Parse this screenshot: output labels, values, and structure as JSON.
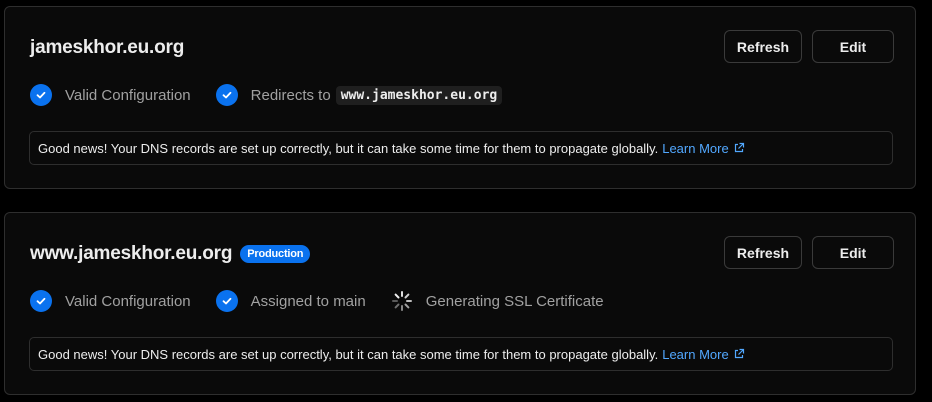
{
  "domains": [
    {
      "name": "jameskhor.eu.org",
      "badge": "",
      "buttons": {
        "refresh": "Refresh",
        "edit": "Edit"
      },
      "statuses": [
        {
          "icon": "check-icon",
          "label": "Valid Configuration"
        },
        {
          "icon": "check-icon",
          "label": "Redirects to",
          "code": "www.jameskhor.eu.org"
        }
      ],
      "notice": {
        "text": "Good news! Your DNS records are set up correctly, but it can take some time for them to propagate globally.",
        "link": "Learn More",
        "link_icon": "external-link-icon"
      }
    },
    {
      "name": "www.jameskhor.eu.org",
      "badge": "Production",
      "buttons": {
        "refresh": "Refresh",
        "edit": "Edit"
      },
      "statuses": [
        {
          "icon": "check-icon",
          "label": "Valid Configuration"
        },
        {
          "icon": "check-icon",
          "label": "Assigned to main"
        },
        {
          "icon": "spinner-icon",
          "label": "Generating SSL Certificate"
        }
      ],
      "notice": {
        "text": "Good news! Your DNS records are set up correctly, but it can take some time for them to propagate globally.",
        "link": "Learn More",
        "link_icon": "external-link-icon"
      }
    }
  ],
  "colors": {
    "accent": "#0a72ef",
    "link": "#52a8ff",
    "background": "#000000",
    "card": "#0a0a0a"
  }
}
